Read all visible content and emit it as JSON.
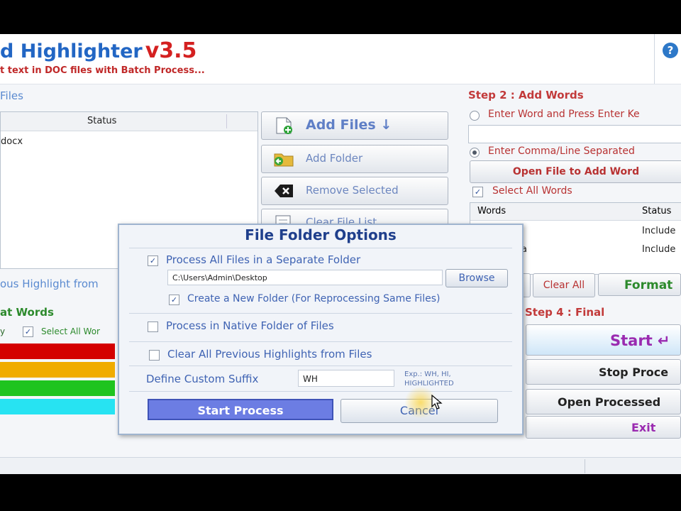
{
  "app": {
    "title": "d Highlighter",
    "version": "v3.5",
    "subtitle": "t text in DOC files with Batch Process...",
    "help_glyph": "?"
  },
  "step1": {
    "label": "Files",
    "status_header": "Status",
    "file_row": "docx",
    "buttons": {
      "add_files": "Add Files ↓",
      "add_folder": "Add Folder",
      "remove_selected": "Remove Selected",
      "clear_file_list": "Clear File List"
    }
  },
  "left_lower": {
    "prev_highlight": "ous Highlight from",
    "format_words": "at Words",
    "col_y": "y",
    "select_all_words": "Select All Wor",
    "swatch_colors": [
      "#d40000",
      "#f0ac00",
      "#1fc41f",
      "#27e3f2"
    ]
  },
  "step2": {
    "label": "Step 2 : Add Words",
    "opt_enter_word": "Enter Word and Press Enter Ke",
    "opt_comma_sep": "Enter Comma/Line Separated",
    "open_file_button": "Open File to Add Word",
    "select_all_words": "Select All Words",
    "col_words": "Words",
    "col_status": "Status",
    "rows": [
      {
        "word": "",
        "status": "Include"
      },
      {
        "word": "a",
        "status": "Include"
      }
    ],
    "clear_all": "Clear All",
    "format": "Format"
  },
  "step4": {
    "label": "Step 4 : Final",
    "start": "Start ↵",
    "stop": "Stop Proce",
    "open_processed": "Open Processed",
    "exit": "Exit"
  },
  "dialog": {
    "title": "File Folder Options",
    "process_separate": "Process All Files in a Separate Folder",
    "path_value": "C:\\Users\\Admin\\Desktop",
    "browse": "Browse",
    "create_new_folder": "Create a New Folder (For Reprocessing Same Files)",
    "process_native": "Process in Native Folder of Files",
    "clear_previous": "Clear All Previous Highlights from Files",
    "custom_suffix_label": "Define Custom Suffix",
    "custom_suffix_value": "WH",
    "example_line1": "Exp.: WH, HI,",
    "example_line2": "HIGHLIGHTED",
    "start_process": "Start Process",
    "cancel": "Cancel",
    "check_glyph": "✓"
  },
  "colors": {
    "accent_blue": "#2266c4",
    "accent_red": "#c23a3a",
    "primary_button": "#6c7de3"
  }
}
